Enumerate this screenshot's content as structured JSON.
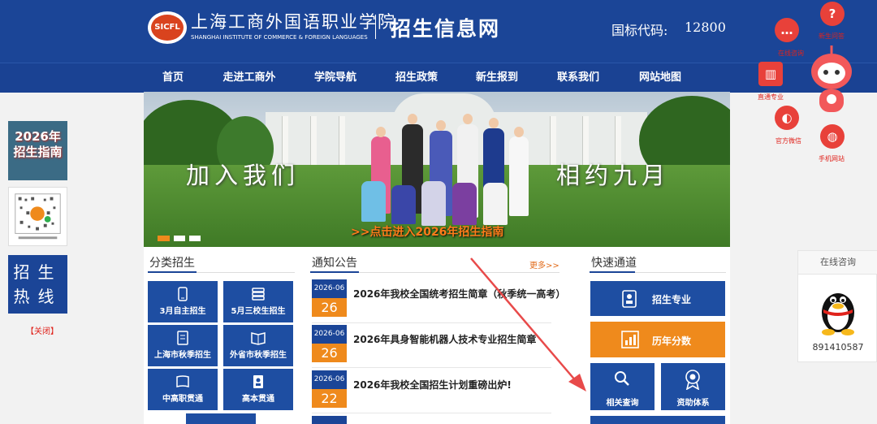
{
  "header": {
    "school_cn": "上海工商外国语职业学院",
    "school_en": "SHANGHAI INSTITUTE OF COMMERCE & FOREIGN LANGUAGES",
    "logo_text": "SICFL",
    "site_name": "招生信息网",
    "code_label": "国标代码:",
    "code_value": "12800"
  },
  "nav": [
    "首页",
    "走进工商外",
    "学院导航",
    "招生政策",
    "新生报到",
    "联系我们",
    "网站地图"
  ],
  "float_right": {
    "items": [
      {
        "label": "在线咨询",
        "icon": "chat-icon"
      },
      {
        "label": "新生问答",
        "icon": "question-icon"
      },
      {
        "label": "直通专业",
        "icon": "book-icon"
      },
      {
        "label": "官方微信",
        "icon": "wechat-icon"
      },
      {
        "label": "手机网站",
        "icon": "globe-icon"
      }
    ],
    "mascot": "robot-mascot"
  },
  "banner": {
    "slogan_left": "加入我们",
    "slogan_right": "相约九月",
    "link": ">>点击进入2026年招生指南",
    "slides": 3,
    "active_slide": 1
  },
  "float_left": {
    "guide_thumb": "2026年 招生指南",
    "hotline": "招生热线",
    "close": "【关闭】"
  },
  "categories": {
    "title": "分类招生",
    "items": [
      {
        "label": "3月自主招生",
        "icon": "phone-icon"
      },
      {
        "label": "5月三校生招生",
        "icon": "stack-icon"
      },
      {
        "label": "上海市秋季招生",
        "icon": "document-icon"
      },
      {
        "label": "外省市秋季招生",
        "icon": "open-book-icon"
      },
      {
        "label": "中高职贯通",
        "icon": "book-icon"
      },
      {
        "label": "高本贯通",
        "icon": "contacts-icon"
      }
    ]
  },
  "notices": {
    "title": "通知公告",
    "more": "更多>>",
    "items": [
      {
        "ym": "2026-06",
        "day": "26",
        "title": "2026年我校全国统考招生简章（秋季统一高考）"
      },
      {
        "ym": "2026-06",
        "day": "26",
        "title": "2026年具身智能机器人技术专业招生简章"
      },
      {
        "ym": "2026-06",
        "day": "22",
        "title": "2026年我校全国招生计划重磅出炉!"
      }
    ]
  },
  "quick": {
    "title": "快速通道",
    "items": [
      {
        "label": "招生专业",
        "icon": "id-card-icon",
        "color": "#1e4ea2"
      },
      {
        "label": "历年分数",
        "icon": "bar-chart-icon",
        "color": "#ef8a1c"
      },
      {
        "label": "相关查询",
        "icon": "search-icon",
        "color": "#1e4ea2"
      },
      {
        "label": "资助体系",
        "icon": "medal-icon",
        "color": "#1e4ea2"
      }
    ]
  },
  "consult": {
    "title": "在线咨询",
    "qq": "891410587",
    "icon": "qq-penguin-icon"
  },
  "colors": {
    "primary": "#1b4597",
    "accent": "#ef8a1c",
    "link_red": "#e0231c"
  }
}
